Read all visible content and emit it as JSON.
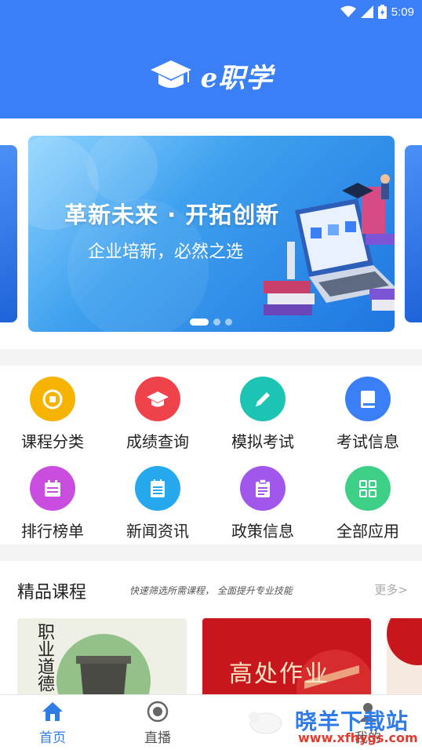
{
  "status": {
    "time": "5:09"
  },
  "header": {
    "logo_text": "e职学"
  },
  "banner": {
    "title": "革新未来 · 开拓创新",
    "subtitle": "企业培新，必然之选"
  },
  "grid": [
    {
      "label": "课程分类",
      "icon": "category-icon",
      "color": "#f6b400"
    },
    {
      "label": "成绩查询",
      "icon": "graduation-cap-icon",
      "color": "#f0424a"
    },
    {
      "label": "模拟考试",
      "icon": "pencil-icon",
      "color": "#1cc4b4"
    },
    {
      "label": "考试信息",
      "icon": "book-icon",
      "color": "#3a7ff6"
    },
    {
      "label": "排行榜单",
      "icon": "calendar-icon",
      "color": "#c94ee0"
    },
    {
      "label": "新闻资讯",
      "icon": "notepad-icon",
      "color": "#26a8ee"
    },
    {
      "label": "政策信息",
      "icon": "clipboard-icon",
      "color": "#a157ec"
    },
    {
      "label": "全部应用",
      "icon": "grid-apps-icon",
      "color": "#3ecf86"
    }
  ],
  "courses": {
    "title": "精品课程",
    "subtitle": "快速筛选所需课程，  全面提升专业技能",
    "more": "更多>",
    "cards": [
      {
        "text": "职业道德",
        "bg": "#eef0e6"
      },
      {
        "text": "高处作业",
        "bg": "#c8161d"
      }
    ]
  },
  "tabs": [
    {
      "label": "首页",
      "icon": "home-icon",
      "active": true
    },
    {
      "label": "直播",
      "icon": "live-icon",
      "active": false
    },
    {
      "label": "我的",
      "icon": "user-icon",
      "active": false
    }
  ],
  "watermark": {
    "text": "晓羊下载站",
    "url": "www.xfhygs.com"
  },
  "colors": {
    "primary": "#3a7ff6",
    "text": "#222222",
    "muted": "#aaaaaa"
  }
}
